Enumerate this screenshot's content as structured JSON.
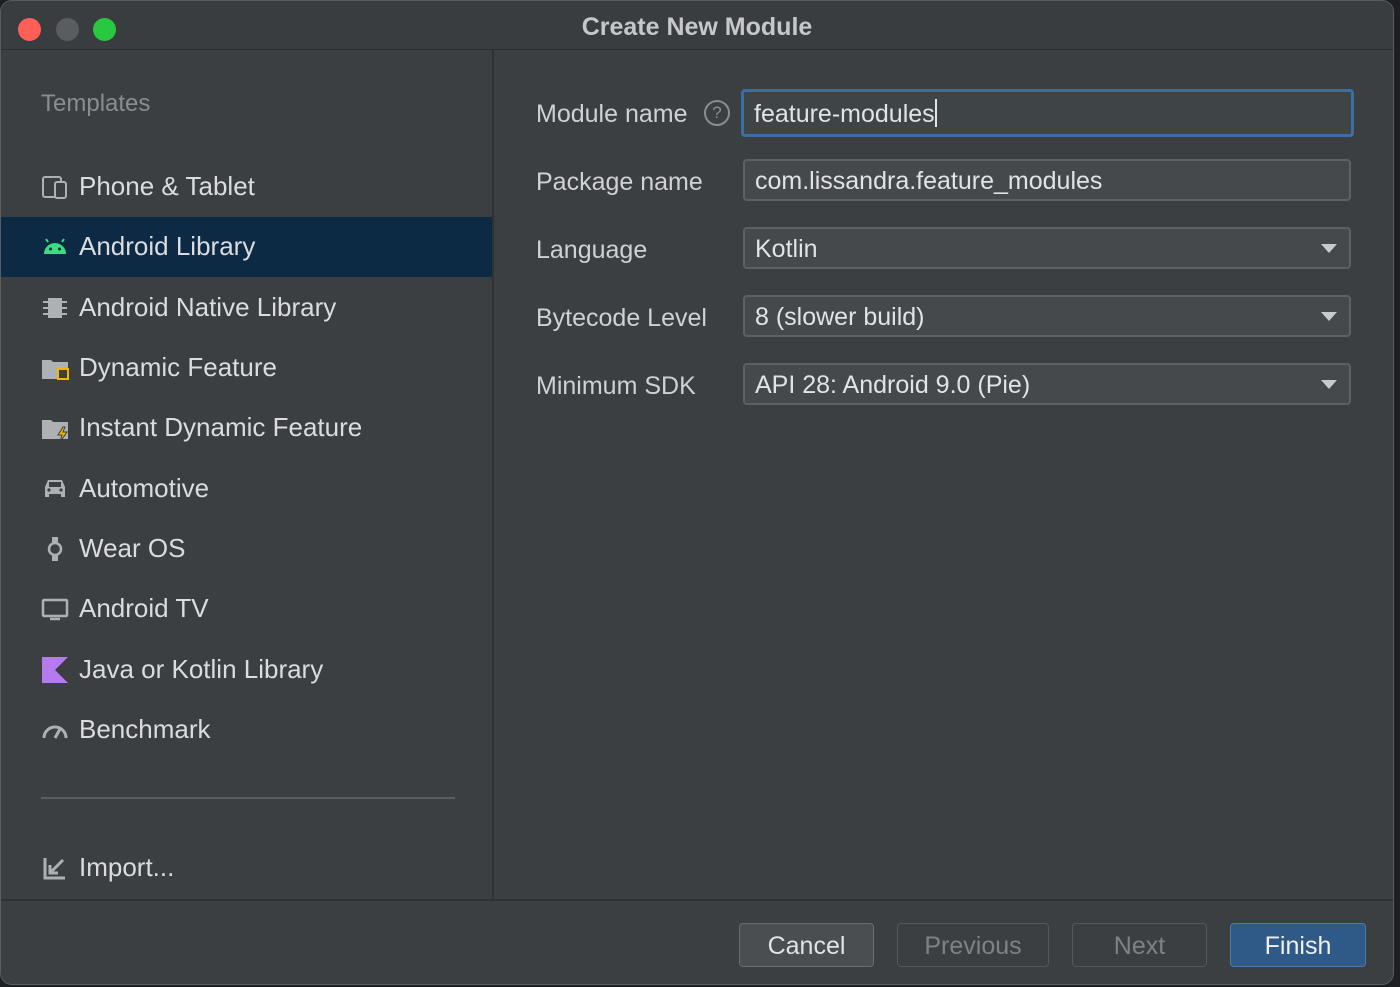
{
  "window": {
    "title": "Create New Module"
  },
  "sidebar": {
    "heading": "Templates",
    "items": [
      {
        "label": "Phone & Tablet",
        "icon": "phone-tablet-icon"
      },
      {
        "label": "Android Library",
        "icon": "android-icon",
        "selected": true
      },
      {
        "label": "Android Native Library",
        "icon": "chip-icon"
      },
      {
        "label": "Dynamic Feature",
        "icon": "folder-module-icon"
      },
      {
        "label": "Instant Dynamic Feature",
        "icon": "folder-instant-icon"
      },
      {
        "label": "Automotive",
        "icon": "car-icon"
      },
      {
        "label": "Wear OS",
        "icon": "watch-icon"
      },
      {
        "label": "Android TV",
        "icon": "tv-icon"
      },
      {
        "label": "Java or Kotlin Library",
        "icon": "kotlin-icon"
      },
      {
        "label": "Benchmark",
        "icon": "gauge-icon"
      }
    ],
    "import_label": "Import..."
  },
  "form": {
    "module_name": {
      "label": "Module name",
      "value": "feature-modules",
      "help": "?"
    },
    "package_name": {
      "label": "Package name",
      "value": "com.lissandra.feature_modules"
    },
    "language": {
      "label": "Language",
      "value": "Kotlin"
    },
    "bytecode_level": {
      "label": "Bytecode Level",
      "value": "8 (slower build)"
    },
    "minimum_sdk": {
      "label": "Minimum SDK",
      "value": "API 28: Android 9.0 (Pie)"
    }
  },
  "buttons": {
    "cancel": "Cancel",
    "previous": "Previous",
    "next": "Next",
    "finish": "Finish"
  },
  "colors": {
    "accent": "#2f5987",
    "selection": "#0d2a44",
    "android_green": "#3ddc84",
    "kotlin_purple": "#b57bee"
  }
}
